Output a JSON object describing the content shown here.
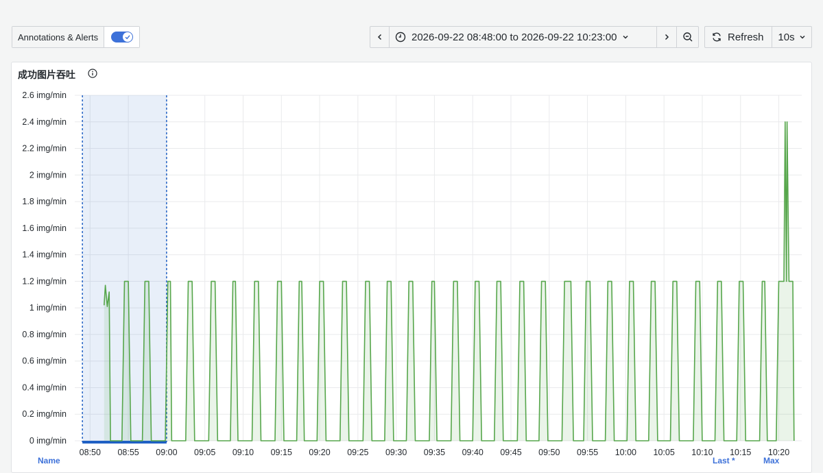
{
  "toolbar": {
    "annotations_label": "Annotations & Alerts",
    "annotations_enabled": true,
    "time_range": "2026-09-22 08:48:00 to 2026-09-22 10:23:00",
    "refresh_label": "Refresh",
    "refresh_interval": "10s"
  },
  "panel": {
    "title": "成功图片吞吐"
  },
  "legend": {
    "col_name": "Name",
    "col_last": "Last *",
    "col_max": "Max"
  },
  "colors": {
    "series": "#56a64b",
    "series_fill": "#56a64b",
    "selection": "#1f60c4",
    "accent": "#3d71d9"
  },
  "chart_data": {
    "type": "line",
    "yunit": "img/min",
    "ylim": [
      0,
      2.6
    ],
    "yticks": [
      "0 img/min",
      "0.2 img/min",
      "0.4 img/min",
      "0.6 img/min",
      "0.8 img/min",
      "1 img/min",
      "1.2 img/min",
      "1.4 img/min",
      "1.6 img/min",
      "1.8 img/min",
      "2 img/min",
      "2.2 img/min",
      "2.4 img/min",
      "2.6 img/min"
    ],
    "xticks": [
      "08:50",
      "08:55",
      "09:00",
      "09:05",
      "09:10",
      "09:15",
      "09:20",
      "09:25",
      "09:30",
      "09:35",
      "09:40",
      "09:45",
      "09:50",
      "09:55",
      "10:00",
      "10:05",
      "10:10",
      "10:15",
      "10:20"
    ],
    "xlim": [
      "08:48:00",
      "10:23:00"
    ],
    "grid": true,
    "selection_region": [
      "08:49",
      "09:00"
    ],
    "series": [
      {
        "points": [
          [
            "08:51:50",
            1.02
          ],
          [
            "08:52:00",
            1.17
          ],
          [
            "08:52:15",
            1.01
          ],
          [
            "08:52:30",
            1.12
          ],
          [
            "08:52:40",
            0
          ],
          [
            "08:54:10",
            0
          ],
          [
            "08:54:30",
            1.2
          ],
          [
            "08:55:00",
            1.2
          ],
          [
            "08:55:20",
            0
          ],
          [
            "08:56:50",
            0
          ],
          [
            "08:57:10",
            1.2
          ],
          [
            "08:57:40",
            1.2
          ],
          [
            "08:58:00",
            0
          ],
          [
            "08:59:50",
            0
          ],
          [
            "09:00:10",
            1.2
          ],
          [
            "09:00:30",
            1.2
          ],
          [
            "09:00:40",
            0
          ],
          [
            "09:02:30",
            0
          ],
          [
            "09:02:50",
            1.2
          ],
          [
            "09:03:20",
            1.2
          ],
          [
            "09:03:40",
            0
          ],
          [
            "09:05:30",
            0
          ],
          [
            "09:05:50",
            1.2
          ],
          [
            "09:06:20",
            1.2
          ],
          [
            "09:06:40",
            0
          ],
          [
            "09:08:20",
            0
          ],
          [
            "09:08:40",
            1.2
          ],
          [
            "09:09:00",
            1.2
          ],
          [
            "09:09:20",
            0
          ],
          [
            "09:11:10",
            0
          ],
          [
            "09:11:30",
            1.2
          ],
          [
            "09:12:00",
            1.2
          ],
          [
            "09:12:20",
            0
          ],
          [
            "09:14:10",
            0
          ],
          [
            "09:14:30",
            1.2
          ],
          [
            "09:15:00",
            1.2
          ],
          [
            "09:15:20",
            0
          ],
          [
            "09:17:00",
            0
          ],
          [
            "09:17:20",
            1.2
          ],
          [
            "09:17:40",
            1.2
          ],
          [
            "09:18:00",
            0
          ],
          [
            "09:19:40",
            0
          ],
          [
            "09:20:00",
            1.2
          ],
          [
            "09:20:30",
            1.2
          ],
          [
            "09:20:50",
            0
          ],
          [
            "09:22:40",
            0
          ],
          [
            "09:23:00",
            1.2
          ],
          [
            "09:23:30",
            1.2
          ],
          [
            "09:23:50",
            0
          ],
          [
            "09:25:40",
            0
          ],
          [
            "09:26:00",
            1.2
          ],
          [
            "09:26:30",
            1.2
          ],
          [
            "09:26:50",
            0
          ],
          [
            "09:28:30",
            0
          ],
          [
            "09:28:50",
            1.2
          ],
          [
            "09:29:20",
            1.2
          ],
          [
            "09:29:40",
            0
          ],
          [
            "09:31:20",
            0
          ],
          [
            "09:31:40",
            1.2
          ],
          [
            "09:32:10",
            1.2
          ],
          [
            "09:32:30",
            0
          ],
          [
            "09:34:20",
            0
          ],
          [
            "09:34:40",
            1.2
          ],
          [
            "09:35:00",
            1.2
          ],
          [
            "09:35:20",
            0
          ],
          [
            "09:37:10",
            0
          ],
          [
            "09:37:30",
            1.2
          ],
          [
            "09:38:00",
            1.2
          ],
          [
            "09:38:20",
            0
          ],
          [
            "09:40:00",
            0
          ],
          [
            "09:40:20",
            1.2
          ],
          [
            "09:40:50",
            1.2
          ],
          [
            "09:41:10",
            0
          ],
          [
            "09:42:50",
            0
          ],
          [
            "09:43:10",
            1.2
          ],
          [
            "09:43:40",
            1.2
          ],
          [
            "09:44:00",
            0
          ],
          [
            "09:45:50",
            0
          ],
          [
            "09:46:10",
            1.2
          ],
          [
            "09:46:40",
            1.2
          ],
          [
            "09:47:00",
            0
          ],
          [
            "09:48:40",
            0
          ],
          [
            "09:49:00",
            1.2
          ],
          [
            "09:49:30",
            1.2
          ],
          [
            "09:49:50",
            0
          ],
          [
            "09:51:40",
            0
          ],
          [
            "09:52:00",
            1.2
          ],
          [
            "09:52:50",
            1.2
          ],
          [
            "09:53:10",
            0
          ],
          [
            "09:54:30",
            0
          ],
          [
            "09:54:50",
            1.2
          ],
          [
            "09:55:20",
            1.2
          ],
          [
            "09:55:40",
            0
          ],
          [
            "09:57:20",
            0
          ],
          [
            "09:57:40",
            1.2
          ],
          [
            "09:58:10",
            1.2
          ],
          [
            "09:58:30",
            0
          ],
          [
            "10:00:10",
            0
          ],
          [
            "10:00:30",
            1.2
          ],
          [
            "10:01:00",
            1.2
          ],
          [
            "10:01:20",
            0
          ],
          [
            "10:03:00",
            0
          ],
          [
            "10:03:20",
            1.2
          ],
          [
            "10:03:50",
            1.2
          ],
          [
            "10:04:10",
            0
          ],
          [
            "10:05:50",
            0
          ],
          [
            "10:06:10",
            1.2
          ],
          [
            "10:06:40",
            1.2
          ],
          [
            "10:07:00",
            0
          ],
          [
            "10:08:50",
            0
          ],
          [
            "10:09:10",
            1.2
          ],
          [
            "10:09:40",
            1.2
          ],
          [
            "10:10:00",
            0
          ],
          [
            "10:11:40",
            0
          ],
          [
            "10:12:00",
            1.2
          ],
          [
            "10:12:30",
            1.2
          ],
          [
            "10:12:50",
            0
          ],
          [
            "10:14:30",
            0
          ],
          [
            "10:14:50",
            1.2
          ],
          [
            "10:15:20",
            1.2
          ],
          [
            "10:15:40",
            0
          ],
          [
            "10:17:30",
            0
          ],
          [
            "10:17:50",
            1.2
          ],
          [
            "10:18:10",
            1.2
          ],
          [
            "10:18:30",
            0
          ],
          [
            "10:19:40",
            0
          ],
          [
            "10:20:00",
            1.2
          ],
          [
            "10:20:40",
            1.2
          ],
          [
            "10:20:50",
            2.4
          ],
          [
            "10:21:00",
            1.2
          ],
          [
            "10:21:05",
            2.4
          ],
          [
            "10:21:20",
            1.2
          ],
          [
            "10:21:50",
            1.2
          ],
          [
            "10:22:00",
            0
          ]
        ]
      }
    ]
  }
}
